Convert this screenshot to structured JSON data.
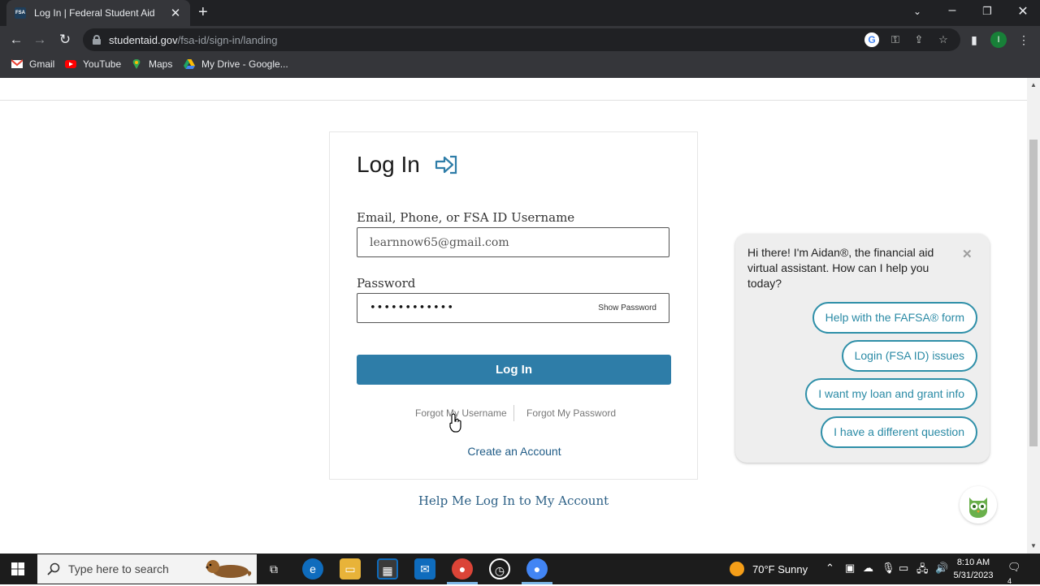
{
  "browser": {
    "tab_title": "Log In | Federal Student Aid",
    "tab_favicon_text": "FSA",
    "url_domain": "studentaid.gov",
    "url_path": "/fsa-id/sign-in/landing",
    "profile_initial": "I",
    "bookmarks": [
      "Gmail",
      "YouTube",
      "Maps",
      "My Drive - Google..."
    ]
  },
  "login": {
    "title": "Log In",
    "username_label": "Email, Phone, or FSA ID Username",
    "username_value": "learnnow65@gmail.com",
    "password_label": "Password",
    "password_masked": "••••••••••••",
    "show_password": "Show Password",
    "login_button": "Log In",
    "forgot_username": "Forgot My Username",
    "forgot_password": "Forgot My Password",
    "create_account": "Create an Account",
    "help_link": "Help Me Log In to My Account"
  },
  "chat": {
    "message": "Hi there! I'm Aidan®, the financial aid virtual assistant. How can I help you today?",
    "options": [
      "Help with the FAFSA® form",
      "Login (FSA ID) issues",
      "I want my loan and grant info",
      "I have a different question"
    ]
  },
  "taskbar": {
    "search_placeholder": "Type here to search",
    "weather": "70°F  Sunny",
    "time": "8:10 AM",
    "date": "5/31/2023",
    "notification_count": "4"
  },
  "colors": {
    "primary_button": "#2e7da8",
    "chip_border": "#2e8fa8",
    "chrome_dark": "#202124",
    "chrome_toolbar": "#35363a"
  }
}
